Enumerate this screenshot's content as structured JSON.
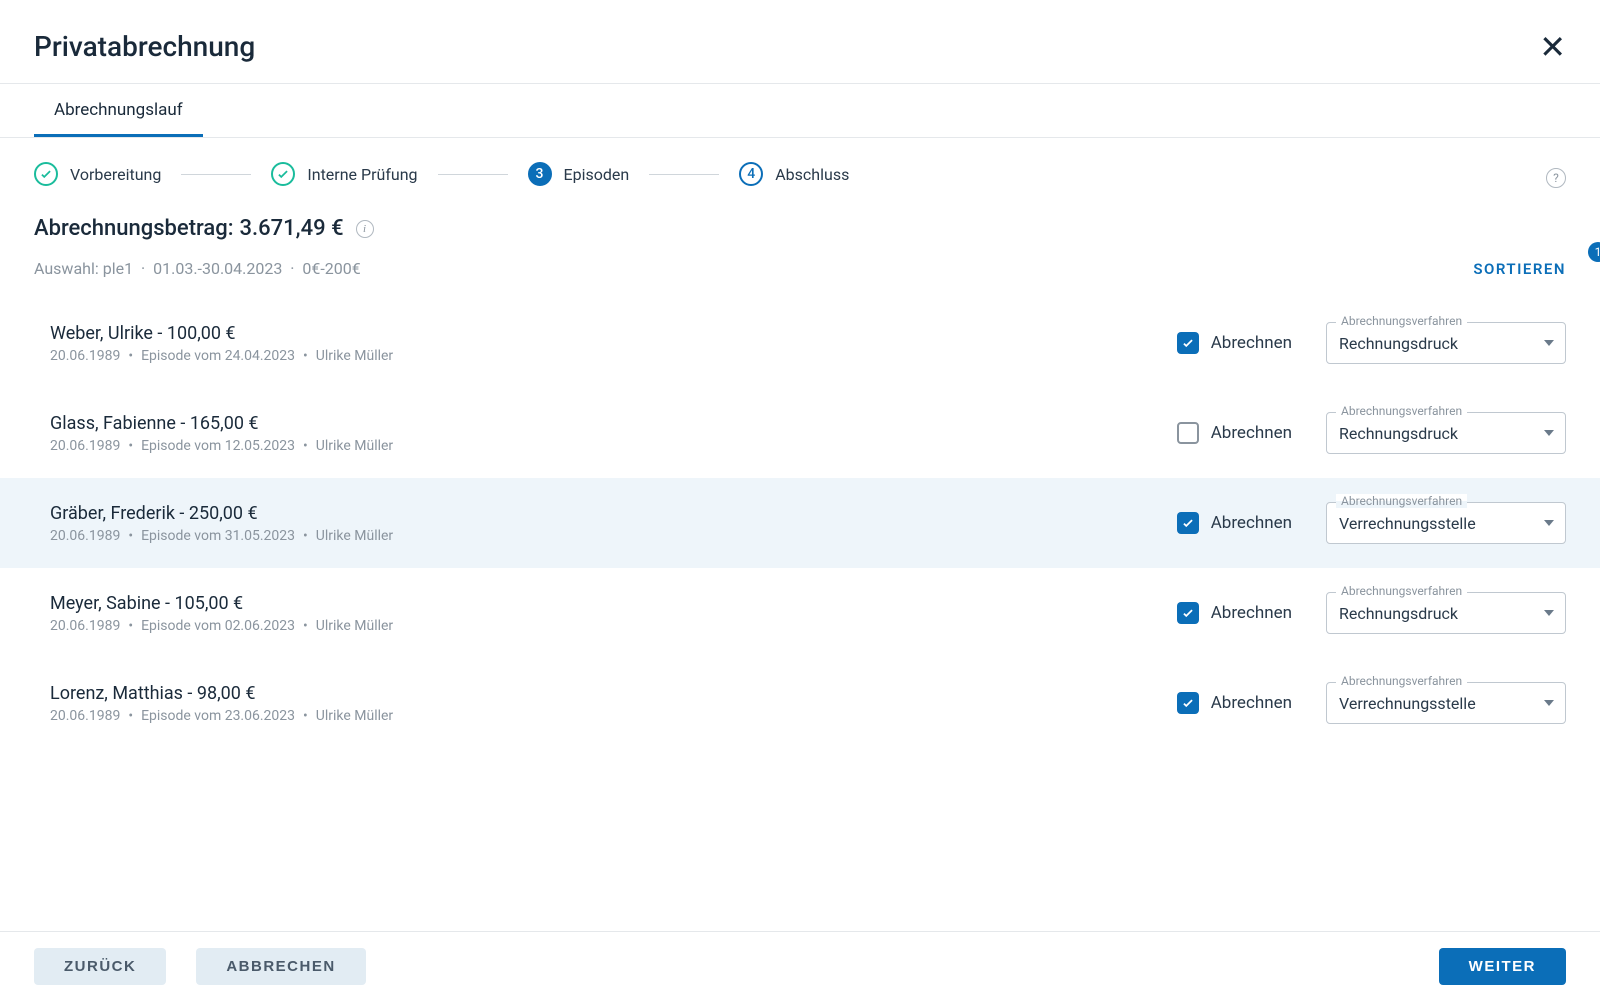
{
  "header": {
    "title": "Privatabrechnung"
  },
  "tabs": {
    "billing_run": "Abrechnungslauf"
  },
  "stepper": {
    "s1": {
      "label": "Vorbereitung"
    },
    "s2": {
      "label": "Interne Prüfung"
    },
    "s3": {
      "num": "3",
      "label": "Episoden"
    },
    "s4": {
      "num": "4",
      "label": "Abschluss"
    }
  },
  "summary": {
    "amount_label": "Abrechnungsbetrag:",
    "amount_value": "3.671,49 €",
    "filter_prefix": "Auswahl:",
    "filter_selection": "ple1",
    "filter_period": "01.03.-30.04.2023",
    "filter_range": "0€-200€"
  },
  "sort": {
    "label": "SORTIEREN",
    "badge": "1"
  },
  "select_label": "Abrechnungsverfahren",
  "check_label": "Abrechnen",
  "episodes": [
    {
      "title": "Weber, Ulrike - 100,00 €",
      "birth": "20.06.1989",
      "episode": "Episode vom 24.04.2023",
      "staff": "Ulrike Müller",
      "checked": true,
      "select": "Rechnungsdruck",
      "highlight": false
    },
    {
      "title": "Glass, Fabienne - 165,00 €",
      "birth": "20.06.1989",
      "episode": "Episode vom 12.05.2023",
      "staff": "Ulrike Müller",
      "checked": false,
      "select": "Rechnungsdruck",
      "highlight": false
    },
    {
      "title": "Gräber, Frederik - 250,00 €",
      "birth": "20.06.1989",
      "episode": "Episode vom 31.05.2023",
      "staff": "Ulrike Müller",
      "checked": true,
      "select": "Verrechnungsstelle",
      "highlight": true
    },
    {
      "title": "Meyer, Sabine - 105,00 €",
      "birth": "20.06.1989",
      "episode": "Episode vom 02.06.2023",
      "staff": "Ulrike Müller",
      "checked": true,
      "select": "Rechnungsdruck",
      "highlight": false
    },
    {
      "title": "Lorenz, Matthias - 98,00 €",
      "birth": "20.06.1989",
      "episode": "Episode vom 23.06.2023",
      "staff": "Ulrike Müller",
      "checked": true,
      "select": "Verrechnungsstelle",
      "highlight": false
    }
  ],
  "footer": {
    "back": "ZURÜCK",
    "cancel": "ABBRECHEN",
    "next": "WEITER"
  }
}
